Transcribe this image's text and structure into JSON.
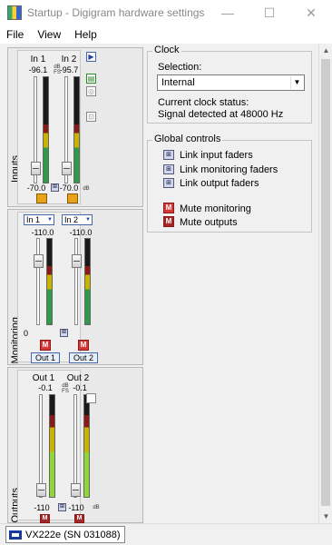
{
  "window": {
    "title": "Startup - Digigram hardware settings",
    "minimize": "—",
    "maximize": "☐",
    "close": "✕"
  },
  "menu": {
    "file": "File",
    "view": "View",
    "help": "Help"
  },
  "inputs": {
    "label": "Inputs",
    "ch1": {
      "name": "In 1",
      "peak": "-96.1",
      "value": "-70.0"
    },
    "ch2": {
      "name": "In 2",
      "peak": "-95.7",
      "value": "-70.0"
    },
    "dbfs_top": "dB FS",
    "db_bottom": "dB",
    "play_icon": "▶",
    "ch_icon1": "▤",
    "ch_icon2": "◎",
    "ch_icon3": "⊡"
  },
  "monitoring": {
    "label": "Monitoring",
    "select1": "In 1",
    "select2": "In 2",
    "ch1_peak": "-110.0",
    "ch2_peak": "-110.0",
    "zero": "0",
    "out1": "Out 1",
    "out2": "Out 2",
    "mute": "M"
  },
  "outputs": {
    "label": "Outputs",
    "ch1": {
      "name": "Out 1",
      "peak": "-0.1",
      "value": "-110"
    },
    "ch2": {
      "name": "Out 2",
      "peak": "-0.1",
      "value": "-110"
    },
    "dbfs_top": "dB FS",
    "db_bottom": "dB",
    "mute": "M"
  },
  "clock": {
    "title": "Clock",
    "selection_label": "Selection:",
    "selection_value": "Internal",
    "status_label": "Current clock status:",
    "status_value": "Signal detected at 48000 Hz"
  },
  "global": {
    "title": "Global controls",
    "link_input": "Link input faders",
    "link_monitoring": "Link monitoring faders",
    "link_output": "Link output faders",
    "mute_monitoring": "Mute monitoring",
    "mute_outputs": "Mute outputs",
    "link_icon": "⊞",
    "mute_icon": "M"
  },
  "status": {
    "device": "VX222e (SN 031088)"
  },
  "levels": {
    "input_meters": [
      0.55,
      0.55
    ],
    "monitor_meters": [
      0.68,
      0.68
    ],
    "output_meters": [
      0.8,
      0.8
    ]
  },
  "colors": {
    "meter_green": "#2f9a4a",
    "meter_yellow": "#c8b400",
    "meter_red": "#8a1a1a",
    "output_green": "#8fd63a"
  }
}
